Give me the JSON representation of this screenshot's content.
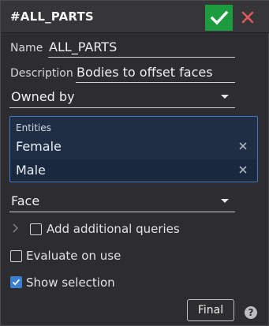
{
  "header": {
    "title": "#ALL_PARTS"
  },
  "colors": {
    "accept": "#1c9b3f",
    "cancel": "#e0585c",
    "selection_border": "#3f79c4",
    "checkbox_checked": "#3b7fd4"
  },
  "form": {
    "name_label": "Name",
    "name_value": "ALL_PARTS",
    "description_label": "Description",
    "description_value": "Bodies to offset faces",
    "owner_select": "Owned by",
    "entities": {
      "label": "Entities",
      "items": [
        {
          "label": "Female"
        },
        {
          "label": "Male"
        }
      ]
    },
    "type_select": "Face",
    "add_queries_label": "Add additional queries",
    "evaluate_label": "Evaluate on use",
    "show_selection_label": "Show selection"
  },
  "footer": {
    "final_label": "Final",
    "help_glyph": "?"
  },
  "icons": {
    "accept": "checkmark-icon",
    "cancel": "close-icon",
    "remove": "remove-x-icon",
    "expand": "chevron-right-icon",
    "help": "help-icon"
  }
}
